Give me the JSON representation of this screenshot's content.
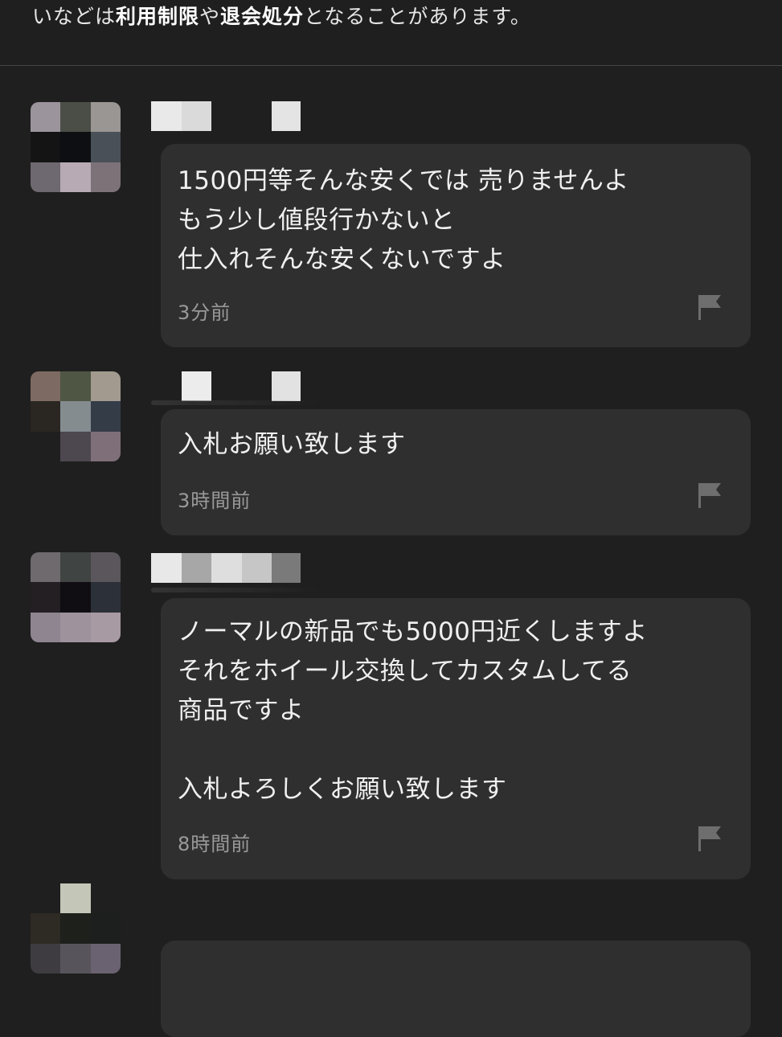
{
  "notice": {
    "text_prefix": "いなどは",
    "bold1": "利用制限",
    "mid": "や",
    "bold2": "退会処分",
    "text_suffix": "となることがあります。"
  },
  "comments": [
    {
      "message": "1500円等そんな安くでは 売りませんよ\nもう少し値段行かないと\n仕入れそんな安くないですよ",
      "time": "3分前",
      "flag_icon": "flag-icon"
    },
    {
      "message": "入札お願い致します",
      "time": "3時間前",
      "flag_icon": "flag-icon"
    },
    {
      "message": "ノーマルの新品でも5000円近くしますよ\nそれをホイール交換してカスタムしてる\n商品ですよ\n\n入札よろしくお願い致します",
      "time": "8時間前",
      "flag_icon": "flag-icon"
    },
    {
      "message": "",
      "time": "",
      "flag_icon": "flag-icon"
    }
  ],
  "colors": {
    "background": "#1f1f1f",
    "bubble": "#2f2f2f",
    "text": "#f0f0f0",
    "muted": "#9a9a9a",
    "flag": "#6e6e6e"
  }
}
